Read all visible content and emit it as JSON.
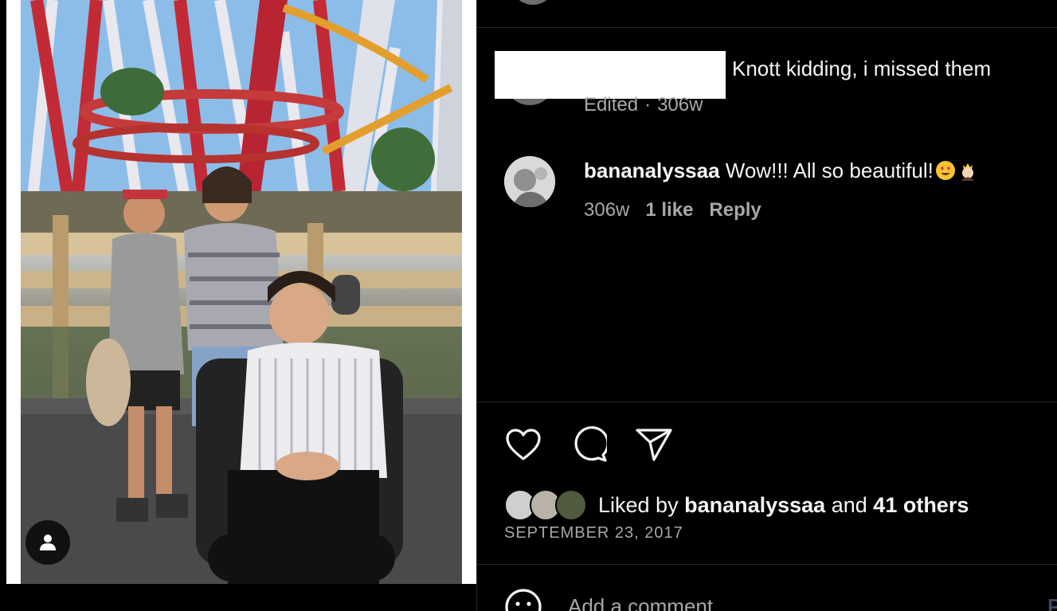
{
  "comments": [
    {
      "text": "Knott kidding, i missed them",
      "meta_edited": "Edited",
      "meta_sep": "·",
      "meta_time": "306w"
    },
    {
      "username": "bananalyssaa",
      "text": "Wow!!! All so beautiful!",
      "emojis": [
        "heart-eyes-emoji",
        "princess-emoji"
      ],
      "time": "306w",
      "likes": "1 like",
      "reply_label": "Reply"
    }
  ],
  "actions": {
    "like_icon": "heart-icon",
    "comment_icon": "comment-icon",
    "share_icon": "paper-plane-icon"
  },
  "likes": {
    "prefix": "Liked by",
    "user": "bananalyssaa",
    "joiner": "and",
    "others": "41 others"
  },
  "post_date": "SEPTEMBER 23, 2017",
  "add_comment": {
    "placeholder": "Add a comment...",
    "post_label": "P"
  },
  "colors": {
    "background": "#000000",
    "secondary_text": "#a8a8a8",
    "divider": "#262626"
  }
}
